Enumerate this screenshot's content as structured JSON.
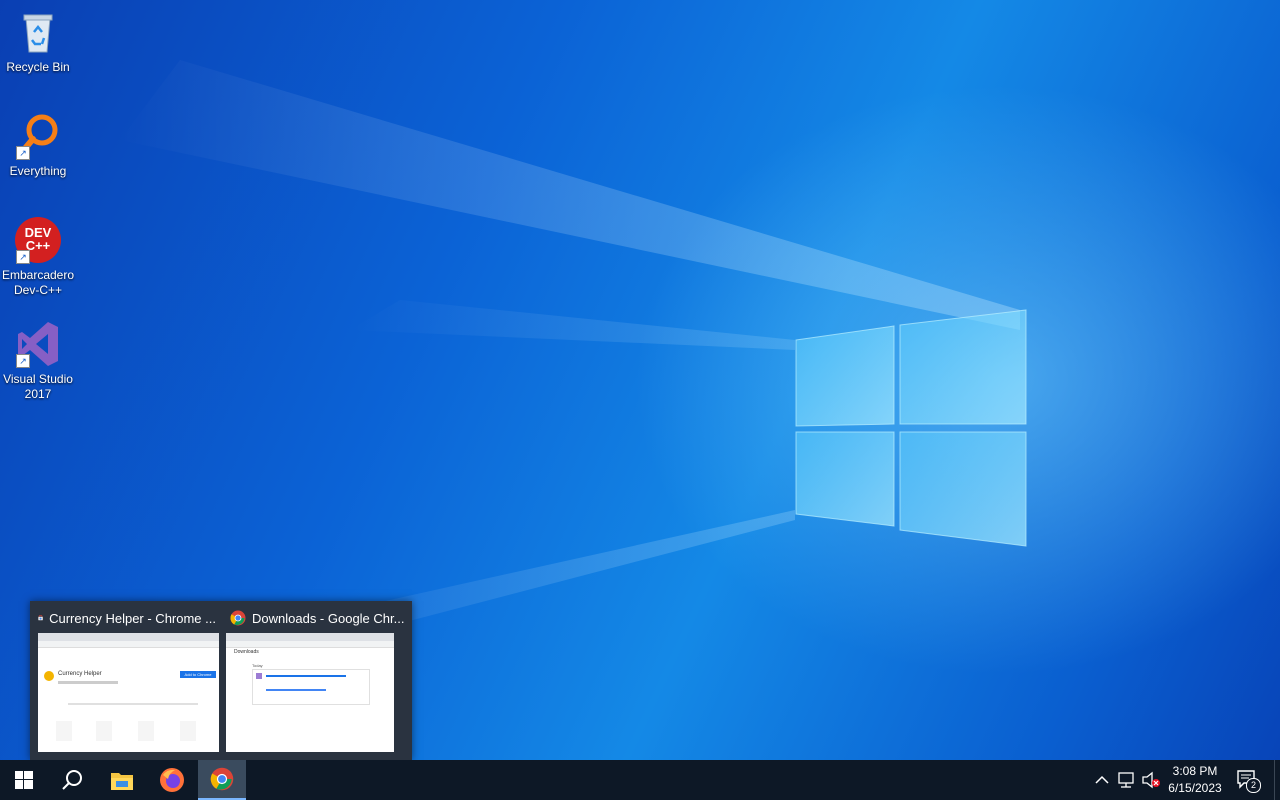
{
  "desktop": {
    "icons": [
      {
        "label": "Recycle Bin",
        "icon": "recycle-bin-icon"
      },
      {
        "label": "Everything",
        "icon": "magnifier-icon"
      },
      {
        "label": "Embarcadero Dev-C++",
        "icon": "devcpp-icon",
        "glyph_text": "DEV C++"
      },
      {
        "label": "Visual Studio 2017",
        "icon": "visual-studio-icon"
      }
    ]
  },
  "thumbnails": [
    {
      "title": "Currency Helper - Chrome ...",
      "icon": "chrome-web-store-icon",
      "preview": {
        "page_heading": "Currency Helper",
        "button": "Add to Chrome"
      }
    },
    {
      "title": "Downloads - Google Chr...",
      "icon": "chrome-icon",
      "preview": {
        "page_heading": "Downloads",
        "item": "Today"
      }
    }
  ],
  "taskbar": {
    "buttons": [
      {
        "name": "start",
        "icon": "windows-logo-icon"
      },
      {
        "name": "search",
        "icon": "search-icon"
      },
      {
        "name": "file-explorer",
        "icon": "folder-icon"
      },
      {
        "name": "firefox",
        "icon": "firefox-icon"
      },
      {
        "name": "chrome",
        "icon": "chrome-icon",
        "active": true
      }
    ],
    "tray": {
      "time": "3:08 PM",
      "date": "6/15/2023",
      "notifications_count": "2"
    }
  }
}
